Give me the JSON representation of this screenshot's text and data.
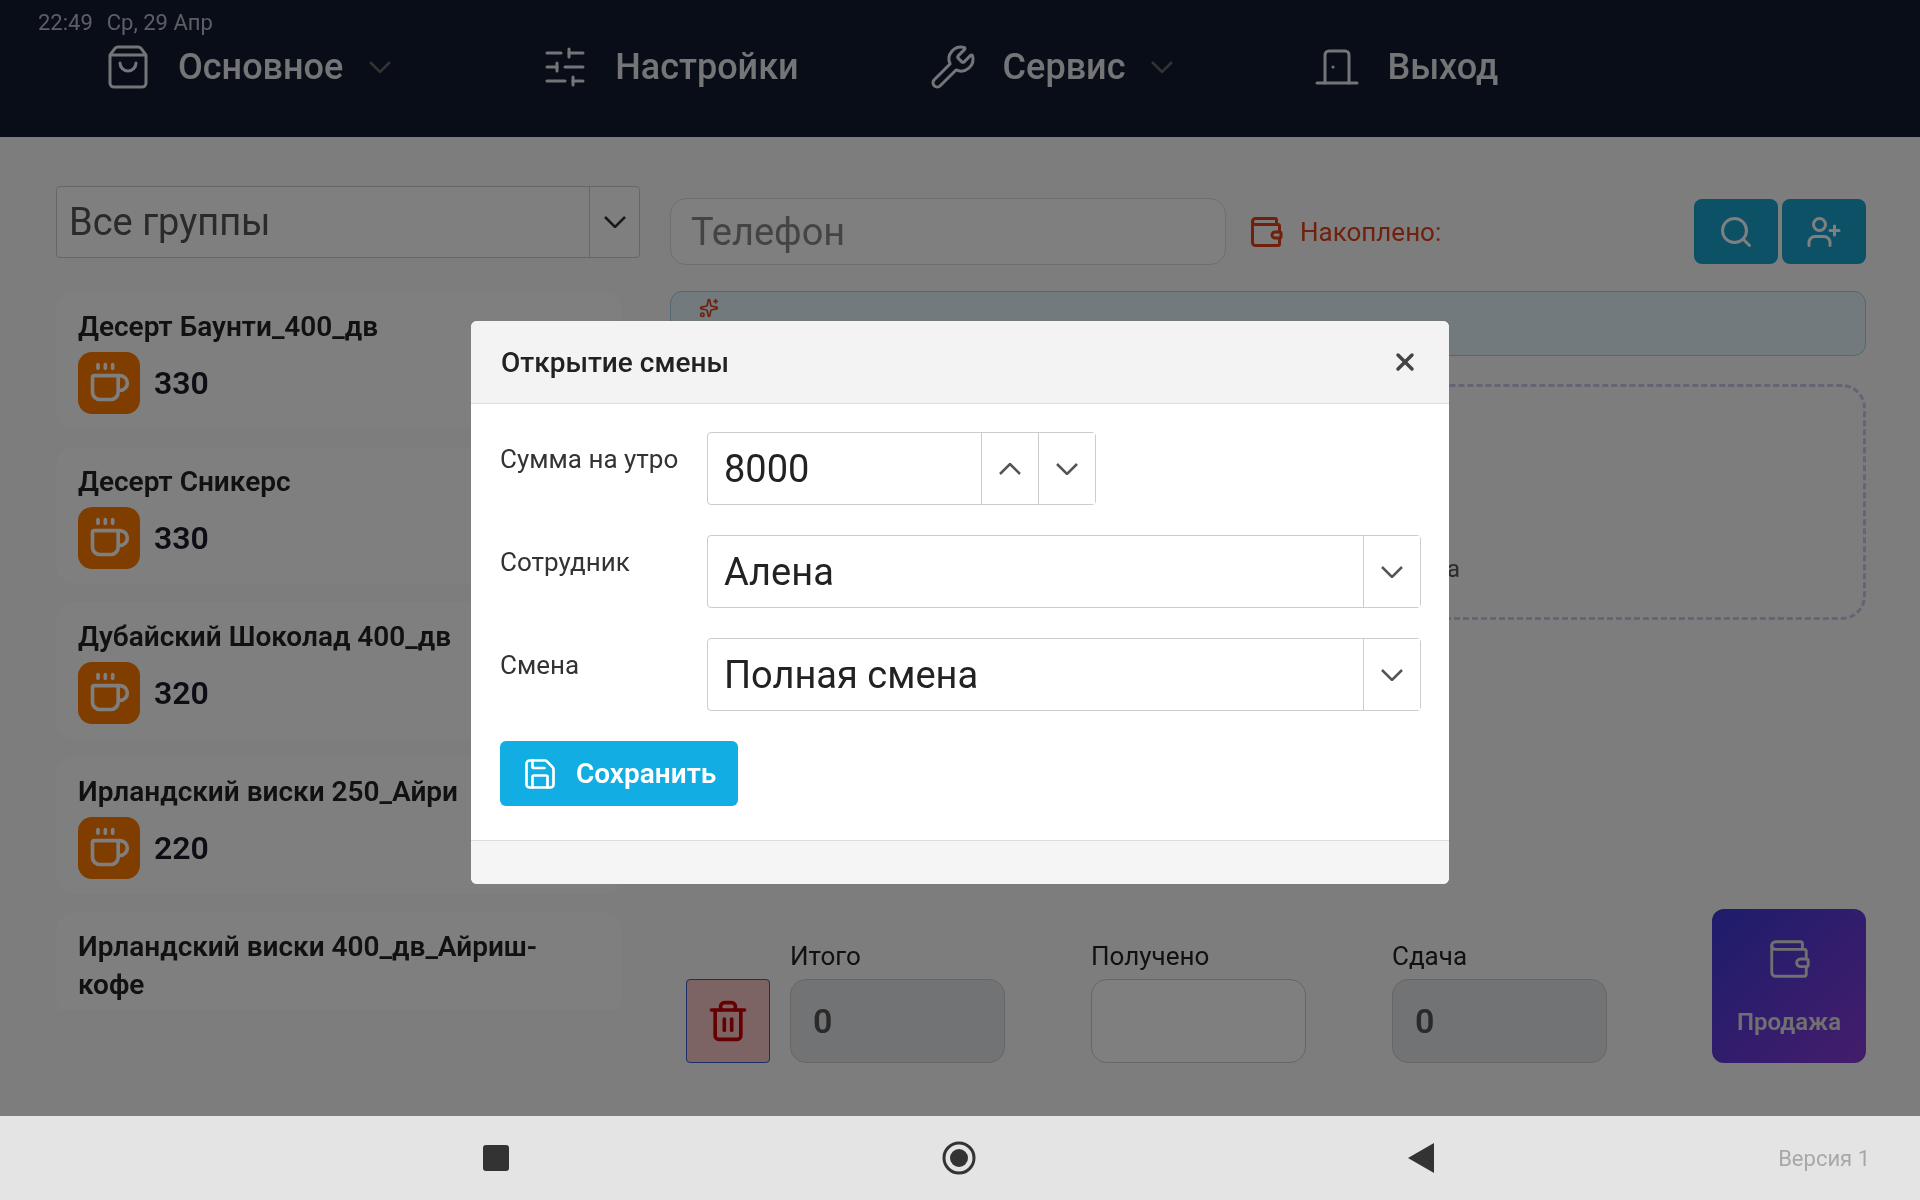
{
  "status_bar": {
    "time": "22:49",
    "date": "Ср, 29 Апр"
  },
  "nav": [
    {
      "kind": "bag",
      "label": "Основное",
      "dropdown": true
    },
    {
      "kind": "sliders",
      "label": "Настройки",
      "dropdown": false
    },
    {
      "kind": "wrench",
      "label": "Сервис",
      "dropdown": true
    },
    {
      "kind": "door",
      "label": "Выход",
      "dropdown": false
    }
  ],
  "groups_select": {
    "value": "Все группы"
  },
  "products": [
    {
      "name": "Десерт Баунти_400_дв",
      "price": "330"
    },
    {
      "name": "Десерт Сникерс",
      "price": "330"
    },
    {
      "name": "Дубайский Шоколад 400_дв",
      "price": "320"
    },
    {
      "name": "Ирландский виски 250_Айри",
      "price": "220"
    },
    {
      "name": "Ирландский виски 400_дв_Айриш-кофе"
    }
  ],
  "phone": {
    "placeholder": "Телефон"
  },
  "accumulated": {
    "label": "Накоплено:"
  },
  "dropzone_hint": "а",
  "totals": [
    {
      "label": "Итого",
      "value": "0"
    },
    {
      "label": "Получено"
    },
    {
      "label": "Сдача",
      "value": "0"
    }
  ],
  "sale_button": "Продажа",
  "modal": {
    "title": "Открытие смены",
    "fields": [
      {
        "kind": "number",
        "label": "Сумма на утро",
        "value": "8000"
      },
      {
        "kind": "select",
        "label": "Сотрудник",
        "value": "Алена"
      },
      {
        "kind": "select",
        "label": "Смена",
        "value": "Полная смена"
      }
    ],
    "save": "Сохранить"
  },
  "version": "Версия 1"
}
